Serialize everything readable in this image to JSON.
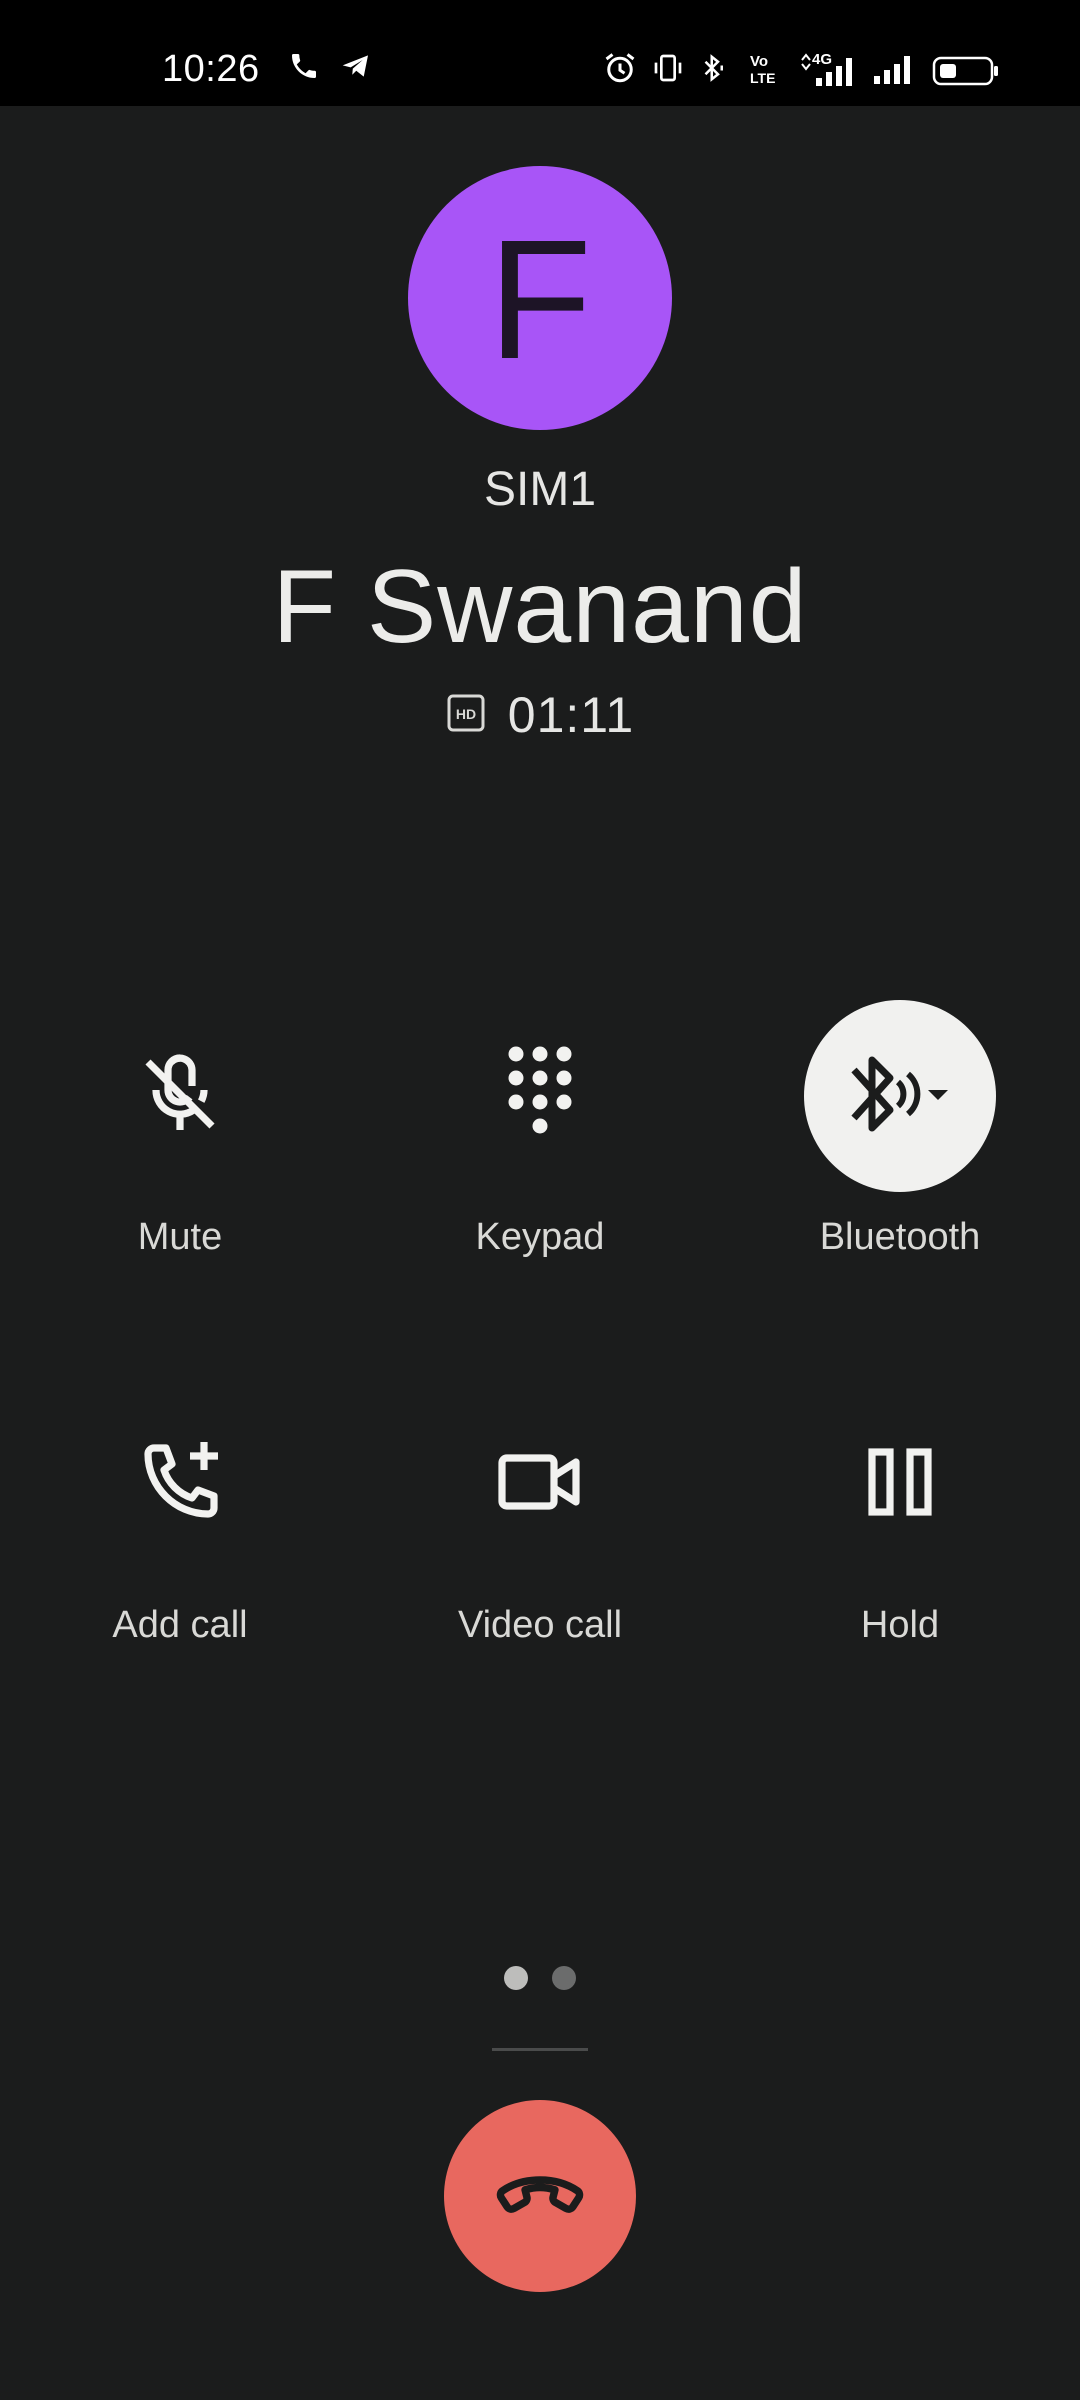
{
  "status_bar": {
    "time": "10:26",
    "icons": [
      "phone-icon",
      "telegram-icon",
      "alarm-icon",
      "vibrate-icon",
      "bluetooth-icon",
      "volte-icon",
      "4g-signal-icon",
      "signal-icon",
      "battery-icon"
    ],
    "volte_text_top": "Vo",
    "volte_text_bottom": "LTE",
    "net_type": "4G"
  },
  "caller": {
    "avatar_letter": "F",
    "avatar_color": "#a855f7",
    "sim": "SIM1",
    "name": "F Swanand",
    "hd_badge": "HD",
    "duration": "01:11"
  },
  "controls": [
    {
      "label": "Mute",
      "icon": "mic-off-icon",
      "active": false
    },
    {
      "label": "Keypad",
      "icon": "dialpad-icon",
      "active": false
    },
    {
      "label": "Bluetooth",
      "icon": "bluetooth-audio-icon",
      "active": true
    },
    {
      "label": "Add call",
      "icon": "add-call-icon",
      "active": false
    },
    {
      "label": "Video call",
      "icon": "video-camera-icon",
      "active": false
    },
    {
      "label": "Hold",
      "icon": "pause-icon",
      "active": false
    }
  ],
  "page_indicator": {
    "count": 2,
    "current": 1,
    "active_color": "#bdbdbb",
    "inactive_color": "#6b6c6c"
  },
  "end_call": {
    "icon": "call-end-icon",
    "color": "#e8685f"
  }
}
